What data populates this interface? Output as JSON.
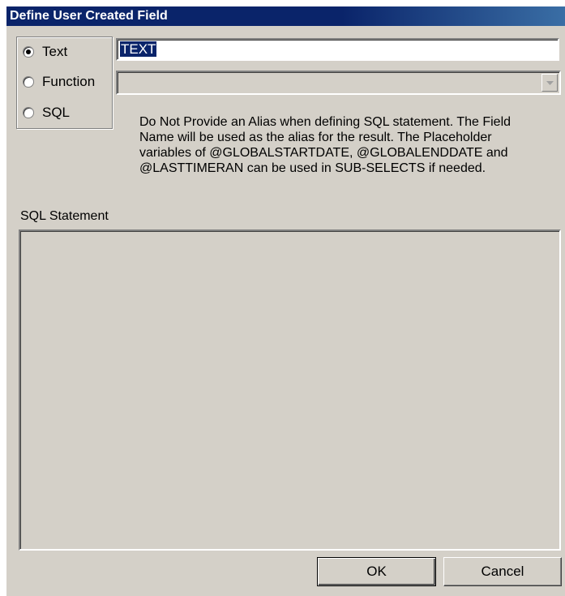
{
  "window": {
    "title": "Define User Created Field"
  },
  "field_type": {
    "options": [
      {
        "label": "Text",
        "checked": true
      },
      {
        "label": "Function",
        "checked": false
      },
      {
        "label": "SQL",
        "checked": false
      }
    ]
  },
  "text_field": {
    "value": "TEXT"
  },
  "function_select": {
    "value": "",
    "enabled": false
  },
  "help": {
    "text": "Do Not Provide an Alias when defining SQL statement. The Field Name will be used as the alias for the result. The Placeholder variables of @GLOBALSTARTDATE, @GLOBALENDDATE and @LASTTIMERAN can be used in SUB-SELECTS if needed."
  },
  "sql": {
    "label": "SQL Statement",
    "value": ""
  },
  "buttons": {
    "ok_label": "OK",
    "cancel_label": "Cancel"
  },
  "colors": {
    "title_bar": "#0a246a",
    "dialog_bg": "#d4d0c8",
    "selection": "#0a246a"
  },
  "icons": {
    "dropdown": "chevron-down-icon"
  }
}
